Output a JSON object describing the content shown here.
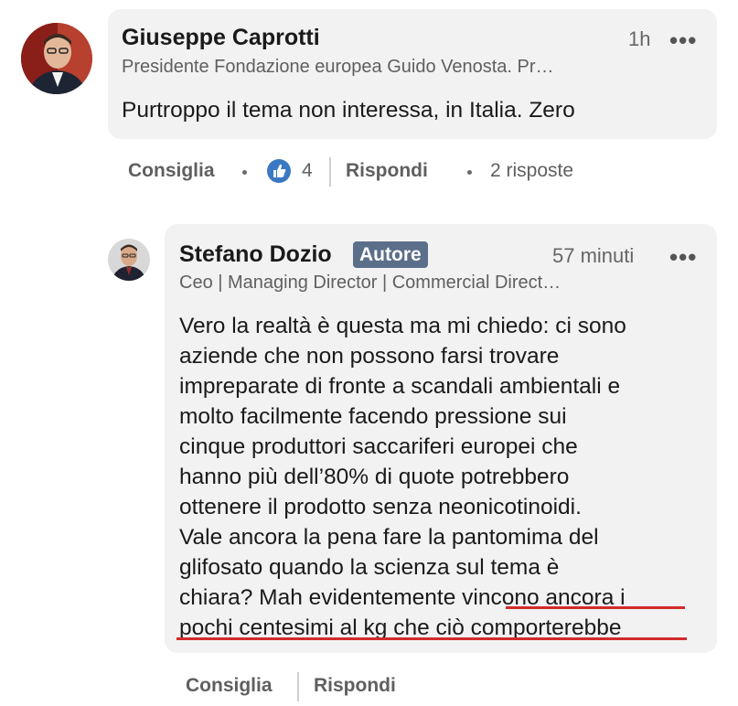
{
  "comment1": {
    "author": "Giuseppe Caprotti",
    "headline": "Presidente Fondazione europea Guido Venosta. Pr…",
    "time": "1h",
    "more_icon": "ellipsis-icon",
    "text": "Purtroppo il tema non interessa, in Italia. Zero",
    "actions": {
      "like_label": "Consiglia",
      "reaction_icon": "thumbs-up-icon",
      "reaction_count": "4",
      "reply_label": "Rispondi",
      "replies": "2 risposte"
    }
  },
  "reply1": {
    "author": "Stefano Dozio",
    "badge": "Autore",
    "headline": "Ceo | Managing Director | Commercial Direct…",
    "time": "57 minuti",
    "more_icon": "ellipsis-icon",
    "lines": [
      "Vero la realtà è questa ma mi chiedo: ci sono",
      "aziende che non possono farsi trovare",
      "impreparate di fronte a scandali ambientali e",
      "molto facilmente facendo pressione sui",
      "cinque produttori saccariferi europei che",
      "hanno più dell’80% di quote potrebbero",
      "ottenere il prodotto senza neonicotinoidi.",
      "Vale ancora la pena fare la pantomima del",
      "glifosato quando la scienza sul tema è",
      "chiara? Mah evidentemente vincono ancora i",
      "pochi centesimi al kg che ciò comporterebbe"
    ],
    "actions": {
      "like_label": "Consiglia",
      "reply_label": "Rispondi"
    }
  },
  "colors": {
    "bubble": "#f2f2f2",
    "badge": "#5b6f8a",
    "like_blue": "#3b78c4",
    "underline": "#d42a2a"
  }
}
